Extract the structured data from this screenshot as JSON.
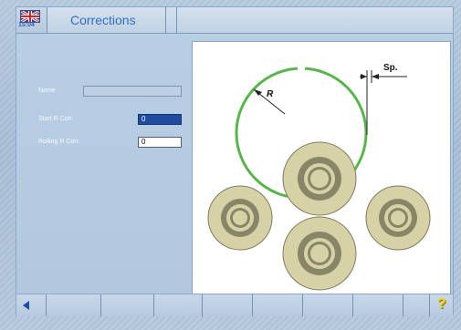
{
  "header": {
    "flag_icon": "uk-flag-icon",
    "time": "15:04",
    "title": "Corrections"
  },
  "form": {
    "name_label": "Name",
    "name_value": "",
    "start_r_corr_label": "Start R Corr.",
    "start_r_corr_value": "0",
    "rolling_r_corr_label": "Rolling R Corr.",
    "rolling_r_corr_value": "0"
  },
  "diagram": {
    "r_label": "R",
    "spacing_label": "Sp."
  },
  "footer": {
    "back_icon": "back-arrow-icon",
    "help_icon": "help-question-icon",
    "help_symbol": "?"
  },
  "colors": {
    "title": "#2f70c0",
    "selected_field": "#1f4c9e",
    "ring_green": "#58b54b",
    "roller_fill": "#d7d2a6",
    "roller_outline": "#7d7b60",
    "roller_core": "#888568"
  }
}
